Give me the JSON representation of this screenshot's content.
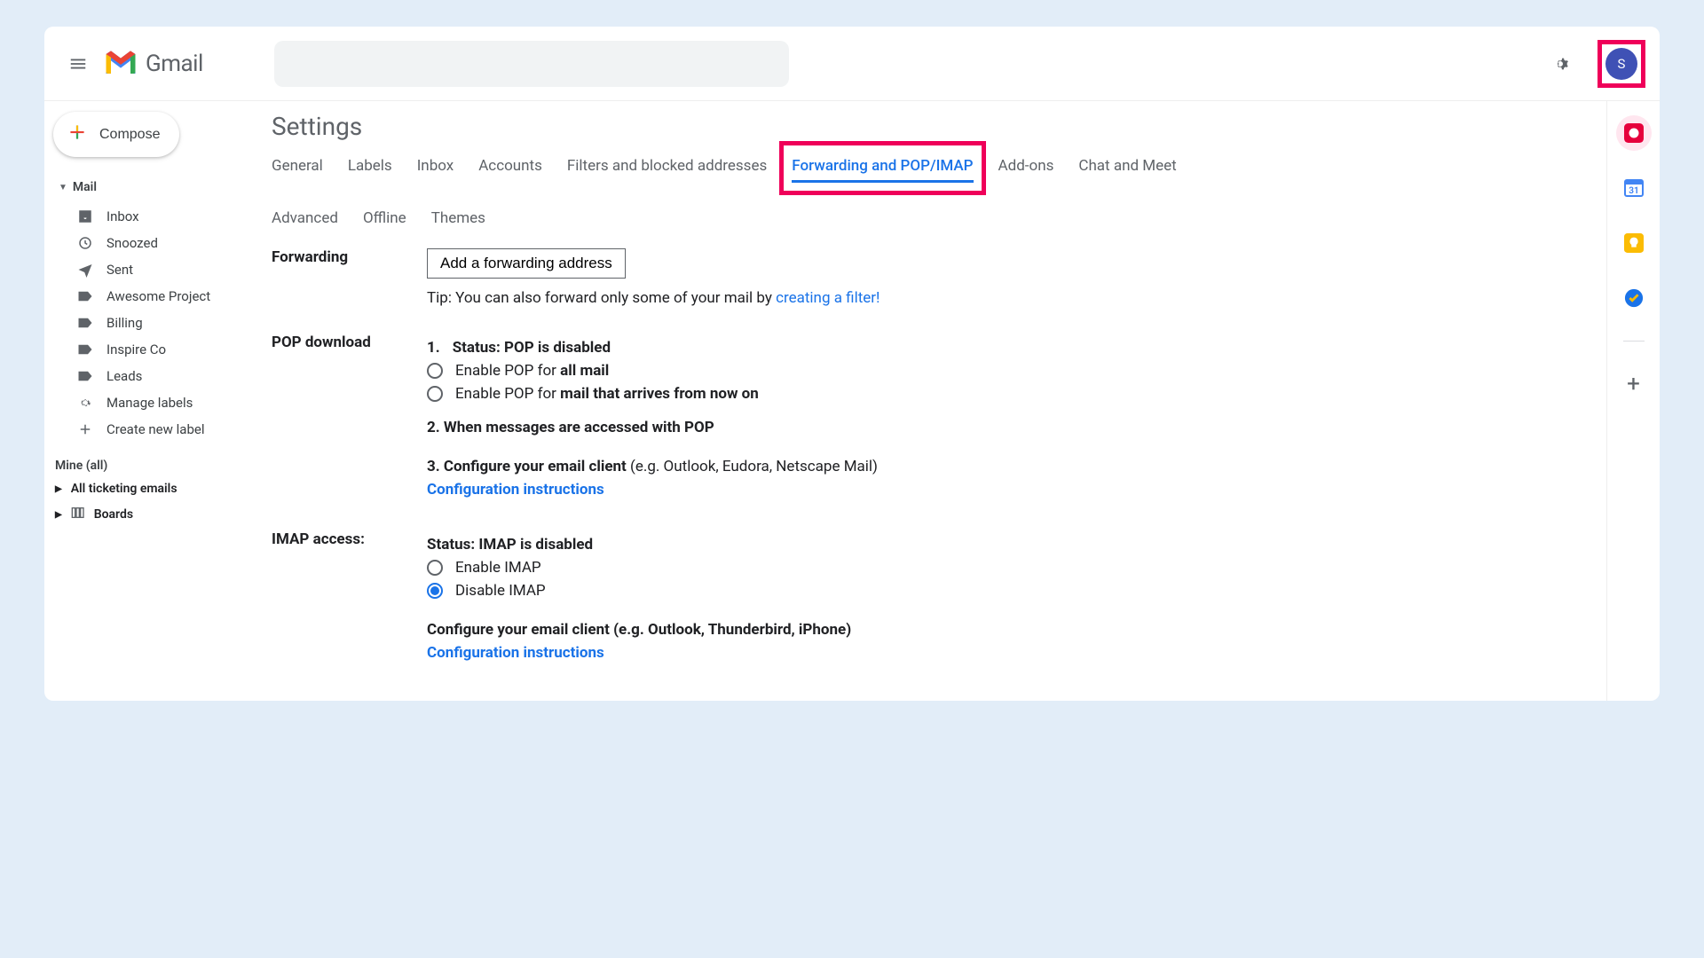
{
  "header": {
    "app_name": "Gmail",
    "avatar_letter": "S"
  },
  "compose_label": "Compose",
  "sidebar": {
    "mail_label": "Mail",
    "items": [
      {
        "label": "Inbox"
      },
      {
        "label": "Snoozed"
      },
      {
        "label": "Sent"
      },
      {
        "label": "Awesome Project"
      },
      {
        "label": "Billing"
      },
      {
        "label": "Inspire Co"
      },
      {
        "label": "Leads"
      },
      {
        "label": "Manage labels"
      },
      {
        "label": "Create new label"
      }
    ],
    "mine_label": "Mine (all)",
    "ticketing_label": "All ticketing emails",
    "boards_label": "Boards"
  },
  "settings": {
    "title": "Settings",
    "tabs": [
      "General",
      "Labels",
      "Inbox",
      "Accounts",
      "Filters and blocked addresses",
      "Forwarding and POP/IMAP",
      "Add-ons",
      "Chat and Meet",
      "Advanced",
      "Offline",
      "Themes"
    ],
    "forwarding": {
      "label": "Forwarding",
      "button": "Add a forwarding address",
      "tip_prefix": "Tip: You can also forward only some of your mail by ",
      "tip_link": "creating a filter!"
    },
    "pop": {
      "label": "POP download",
      "status_num": "1.",
      "status_prefix": "Status: ",
      "status_value": "POP is disabled",
      "opt1_prefix": "Enable POP for ",
      "opt1_bold": "all mail",
      "opt2_prefix": "Enable POP for ",
      "opt2_bold": "mail that arrives from now on",
      "step2": "2. When messages are accessed with POP",
      "step3_bold": "3. Configure your email client",
      "step3_rest": " (e.g. Outlook, Eudora, Netscape Mail)",
      "config_link": "Configuration instructions"
    },
    "imap": {
      "label": "IMAP access:",
      "status_prefix": "Status: ",
      "status_value": "IMAP is disabled",
      "opt_enable": "Enable IMAP",
      "opt_disable": "Disable IMAP",
      "conf_line": "Configure your email client (e.g. Outlook, Thunderbird, iPhone)",
      "config_link": "Configuration instructions"
    }
  },
  "rail": {
    "calendar_day": "31"
  }
}
